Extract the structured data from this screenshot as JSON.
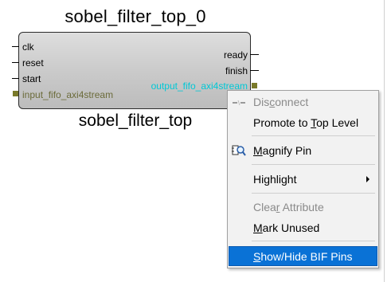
{
  "instance_name": "sobel_filter_top_0",
  "module_name": "sobel_filter_top",
  "pins": {
    "left": [
      "clk",
      "reset",
      "start",
      "input_fifo_axi4stream"
    ],
    "right": [
      "ready",
      "finish",
      "output_fifo_axi4stream"
    ]
  },
  "colors": {
    "bus_left_label": "#6b6b3a",
    "bus_right_label": "#00c8d6",
    "menu_highlight": "#0a72d6"
  },
  "context_menu": {
    "items": [
      {
        "pre": "Dis",
        "u": "c",
        "post": "onnect",
        "enabled": false,
        "icon": "disconnect-icon"
      },
      {
        "pre": "Promote to ",
        "u": "T",
        "post": "op Level",
        "enabled": true
      },
      {
        "pre": "",
        "u": "M",
        "post": "agnify Pin",
        "enabled": true,
        "icon": "magnify-pin-icon"
      },
      {
        "pre": "Highlight",
        "u": "",
        "post": "",
        "enabled": true,
        "submenu": true
      },
      {
        "pre": "Clea",
        "u": "r",
        "post": " Attribute",
        "enabled": false
      },
      {
        "pre": "",
        "u": "M",
        "post": "ark Unused",
        "enabled": true
      },
      {
        "pre": "",
        "u": "S",
        "post": "how/Hide BIF Pins",
        "enabled": true,
        "selected": true
      }
    ]
  }
}
